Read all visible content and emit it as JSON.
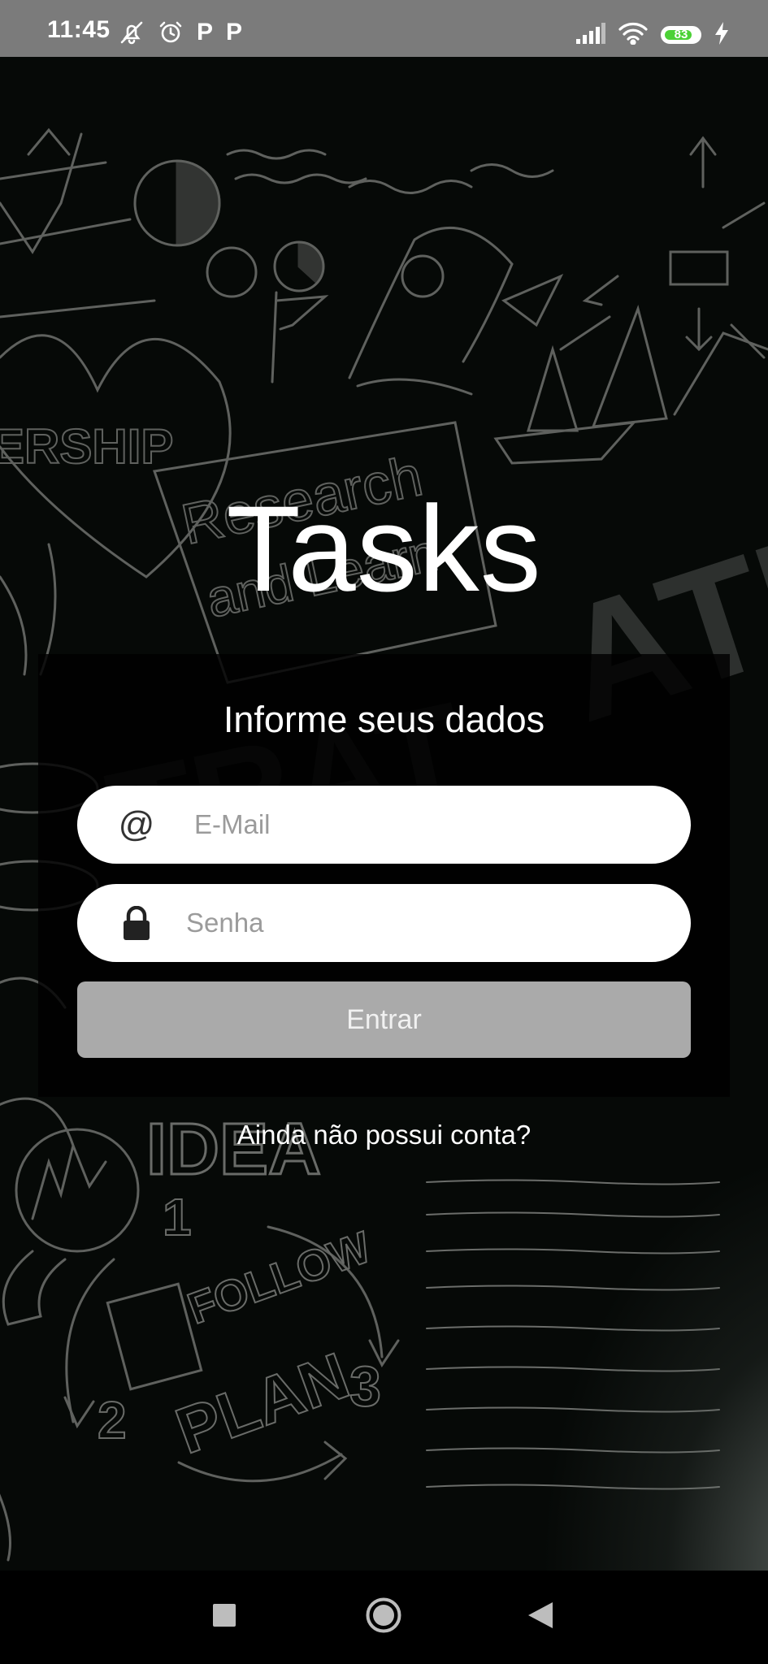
{
  "status_bar": {
    "time": "11:45",
    "left_icons": [
      "notifications-off-icon",
      "alarm-icon",
      "p-app-icon",
      "p-app-icon"
    ],
    "p_label": "P",
    "right_icons": [
      "signal-icon",
      "wifi-icon",
      "battery-icon",
      "charging-icon"
    ],
    "battery_level": "83",
    "battery_fraction": 0.83
  },
  "app": {
    "title": "Tasks"
  },
  "login_form": {
    "heading": "Informe seus dados",
    "email_placeholder": "E-Mail",
    "email_icon": "@",
    "password_placeholder": "Senha",
    "submit_label": "Entrar",
    "submit_color": "#aaaaaa"
  },
  "signup_prompt": "Ainda não possui conta?",
  "nav_bar": {
    "buttons": [
      "recents-icon",
      "home-icon",
      "back-icon"
    ]
  }
}
